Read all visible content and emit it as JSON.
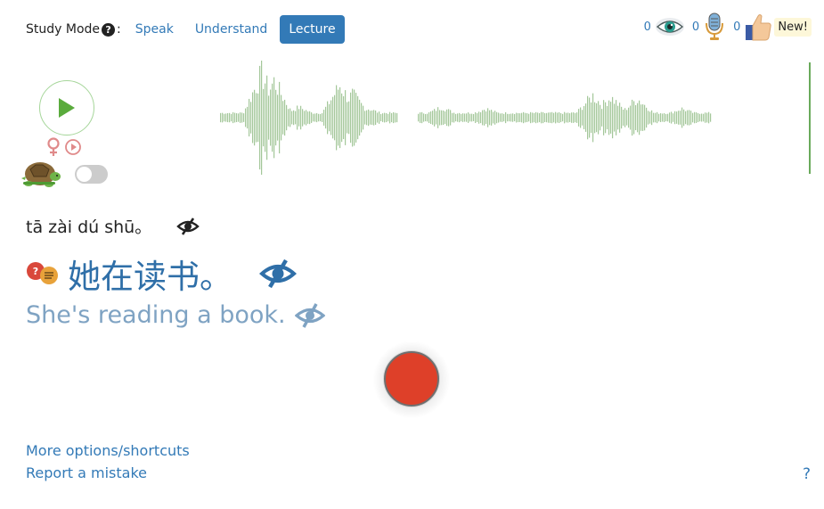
{
  "study_mode": {
    "label": "Study Mode",
    "help_glyph": "?",
    "colon": ":",
    "tabs": [
      {
        "label": "Speak",
        "active": false
      },
      {
        "label": "Understand",
        "active": false
      },
      {
        "label": "Lecture",
        "active": true
      }
    ]
  },
  "stats": {
    "views_count": "0",
    "recordings_count": "0",
    "likes_count": "0",
    "new_badge": "New!",
    "icons": [
      "eye-icon",
      "microphone-icon",
      "thumbs-up-icon"
    ]
  },
  "player": {
    "play_icon": "play-icon",
    "voice_icons": [
      "female-icon",
      "replay-icon"
    ],
    "slow_icon": "turtle-icon",
    "slow_mode_on": false
  },
  "sentence": {
    "pinyin": "tā zài dú shū。",
    "hanzi": "她在读书。",
    "translation": "She's reading a book."
  },
  "links": {
    "more_options": "More options/shortcuts",
    "report": "Report a mistake",
    "help": "?"
  },
  "colors": {
    "accent": "#337ab7",
    "hanzi": "#2f6fa8",
    "translation": "#7fa3c3",
    "waveform": "#a4c79a",
    "play_green": "#5aab3c",
    "record_red": "#de4029"
  }
}
